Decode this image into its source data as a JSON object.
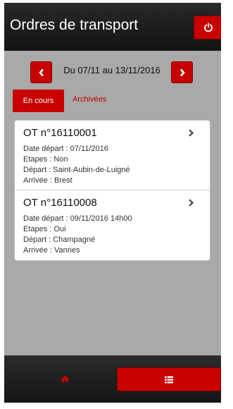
{
  "header": {
    "title": "Ordres de transport",
    "logout_icon": "power-icon"
  },
  "date_nav": {
    "prev_icon": "chevron-left-icon",
    "range": "Du 07/11 au 13/11/2016",
    "next_icon": "chevron-right-icon"
  },
  "tabs": {
    "active": "En cours",
    "other": "Archivées"
  },
  "orders": [
    {
      "title": "OT n°16110001",
      "date": "Date départ : 07/11/2016",
      "etapes": "Etapes : Non",
      "depart": "Départ : Saint-Aubin-de-Luigné",
      "arrivee": "Arrivée : Brest"
    },
    {
      "title": "OT n°16110008",
      "date": "Date départ : 09/11/2016 14h00",
      "etapes": "Etapes : Oui",
      "depart": "Départ : Champagné",
      "arrivee": "Arrivée : Vannes"
    }
  ],
  "footer": {
    "home_icon": "home-icon",
    "list_icon": "list-icon"
  },
  "colors": {
    "accent": "#c80000",
    "background": "#a9a9a9",
    "bar": "#1c1c1c"
  }
}
